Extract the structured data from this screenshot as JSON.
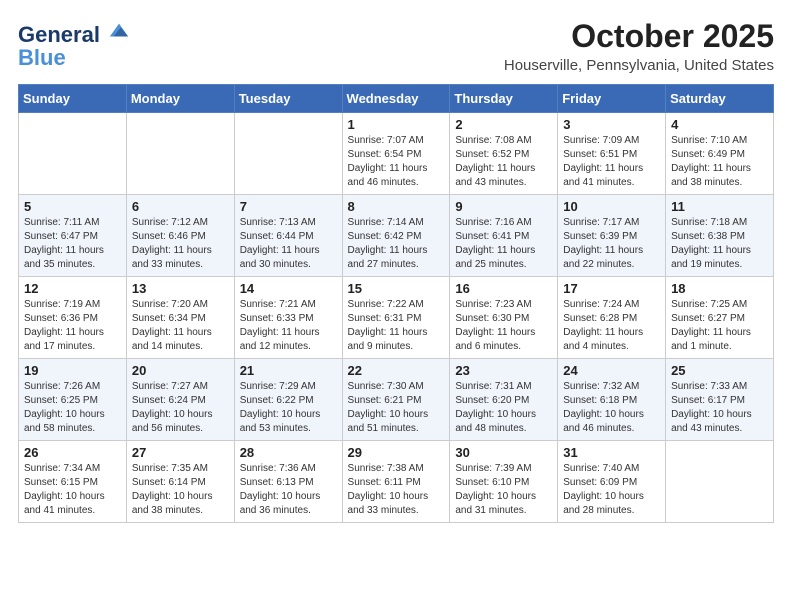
{
  "header": {
    "logo_line1": "General",
    "logo_line2": "Blue",
    "month_year": "October 2025",
    "location": "Houserville, Pennsylvania, United States"
  },
  "days_of_week": [
    "Sunday",
    "Monday",
    "Tuesday",
    "Wednesday",
    "Thursday",
    "Friday",
    "Saturday"
  ],
  "weeks": [
    [
      {
        "day": "",
        "info": ""
      },
      {
        "day": "",
        "info": ""
      },
      {
        "day": "",
        "info": ""
      },
      {
        "day": "1",
        "info": "Sunrise: 7:07 AM\nSunset: 6:54 PM\nDaylight: 11 hours\nand 46 minutes."
      },
      {
        "day": "2",
        "info": "Sunrise: 7:08 AM\nSunset: 6:52 PM\nDaylight: 11 hours\nand 43 minutes."
      },
      {
        "day": "3",
        "info": "Sunrise: 7:09 AM\nSunset: 6:51 PM\nDaylight: 11 hours\nand 41 minutes."
      },
      {
        "day": "4",
        "info": "Sunrise: 7:10 AM\nSunset: 6:49 PM\nDaylight: 11 hours\nand 38 minutes."
      }
    ],
    [
      {
        "day": "5",
        "info": "Sunrise: 7:11 AM\nSunset: 6:47 PM\nDaylight: 11 hours\nand 35 minutes."
      },
      {
        "day": "6",
        "info": "Sunrise: 7:12 AM\nSunset: 6:46 PM\nDaylight: 11 hours\nand 33 minutes."
      },
      {
        "day": "7",
        "info": "Sunrise: 7:13 AM\nSunset: 6:44 PM\nDaylight: 11 hours\nand 30 minutes."
      },
      {
        "day": "8",
        "info": "Sunrise: 7:14 AM\nSunset: 6:42 PM\nDaylight: 11 hours\nand 27 minutes."
      },
      {
        "day": "9",
        "info": "Sunrise: 7:16 AM\nSunset: 6:41 PM\nDaylight: 11 hours\nand 25 minutes."
      },
      {
        "day": "10",
        "info": "Sunrise: 7:17 AM\nSunset: 6:39 PM\nDaylight: 11 hours\nand 22 minutes."
      },
      {
        "day": "11",
        "info": "Sunrise: 7:18 AM\nSunset: 6:38 PM\nDaylight: 11 hours\nand 19 minutes."
      }
    ],
    [
      {
        "day": "12",
        "info": "Sunrise: 7:19 AM\nSunset: 6:36 PM\nDaylight: 11 hours\nand 17 minutes."
      },
      {
        "day": "13",
        "info": "Sunrise: 7:20 AM\nSunset: 6:34 PM\nDaylight: 11 hours\nand 14 minutes."
      },
      {
        "day": "14",
        "info": "Sunrise: 7:21 AM\nSunset: 6:33 PM\nDaylight: 11 hours\nand 12 minutes."
      },
      {
        "day": "15",
        "info": "Sunrise: 7:22 AM\nSunset: 6:31 PM\nDaylight: 11 hours\nand 9 minutes."
      },
      {
        "day": "16",
        "info": "Sunrise: 7:23 AM\nSunset: 6:30 PM\nDaylight: 11 hours\nand 6 minutes."
      },
      {
        "day": "17",
        "info": "Sunrise: 7:24 AM\nSunset: 6:28 PM\nDaylight: 11 hours\nand 4 minutes."
      },
      {
        "day": "18",
        "info": "Sunrise: 7:25 AM\nSunset: 6:27 PM\nDaylight: 11 hours\nand 1 minute."
      }
    ],
    [
      {
        "day": "19",
        "info": "Sunrise: 7:26 AM\nSunset: 6:25 PM\nDaylight: 10 hours\nand 58 minutes."
      },
      {
        "day": "20",
        "info": "Sunrise: 7:27 AM\nSunset: 6:24 PM\nDaylight: 10 hours\nand 56 minutes."
      },
      {
        "day": "21",
        "info": "Sunrise: 7:29 AM\nSunset: 6:22 PM\nDaylight: 10 hours\nand 53 minutes."
      },
      {
        "day": "22",
        "info": "Sunrise: 7:30 AM\nSunset: 6:21 PM\nDaylight: 10 hours\nand 51 minutes."
      },
      {
        "day": "23",
        "info": "Sunrise: 7:31 AM\nSunset: 6:20 PM\nDaylight: 10 hours\nand 48 minutes."
      },
      {
        "day": "24",
        "info": "Sunrise: 7:32 AM\nSunset: 6:18 PM\nDaylight: 10 hours\nand 46 minutes."
      },
      {
        "day": "25",
        "info": "Sunrise: 7:33 AM\nSunset: 6:17 PM\nDaylight: 10 hours\nand 43 minutes."
      }
    ],
    [
      {
        "day": "26",
        "info": "Sunrise: 7:34 AM\nSunset: 6:15 PM\nDaylight: 10 hours\nand 41 minutes."
      },
      {
        "day": "27",
        "info": "Sunrise: 7:35 AM\nSunset: 6:14 PM\nDaylight: 10 hours\nand 38 minutes."
      },
      {
        "day": "28",
        "info": "Sunrise: 7:36 AM\nSunset: 6:13 PM\nDaylight: 10 hours\nand 36 minutes."
      },
      {
        "day": "29",
        "info": "Sunrise: 7:38 AM\nSunset: 6:11 PM\nDaylight: 10 hours\nand 33 minutes."
      },
      {
        "day": "30",
        "info": "Sunrise: 7:39 AM\nSunset: 6:10 PM\nDaylight: 10 hours\nand 31 minutes."
      },
      {
        "day": "31",
        "info": "Sunrise: 7:40 AM\nSunset: 6:09 PM\nDaylight: 10 hours\nand 28 minutes."
      },
      {
        "day": "",
        "info": ""
      }
    ]
  ]
}
